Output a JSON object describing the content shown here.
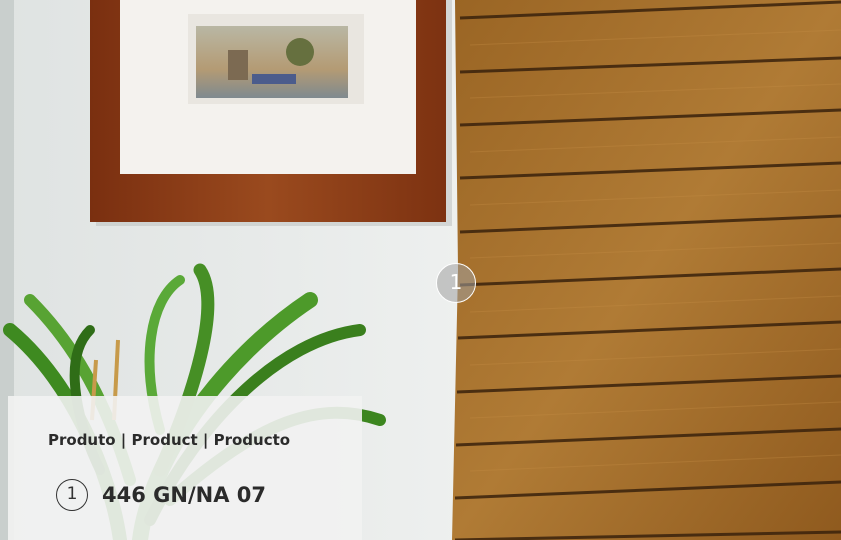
{
  "scene": {
    "description_icons": [
      "framed-picture",
      "wood-plank-wall",
      "potted-plant"
    ]
  },
  "marker": {
    "number": "1"
  },
  "panel": {
    "title": "Produto | Product | Producto",
    "items": [
      {
        "number": "1",
        "code": "446 GN/NA 07"
      }
    ]
  },
  "colors": {
    "wall": "#e6e9e8",
    "wood": "#a8742c",
    "frame": "#8b3a16",
    "leaf": "#3f8a22"
  }
}
